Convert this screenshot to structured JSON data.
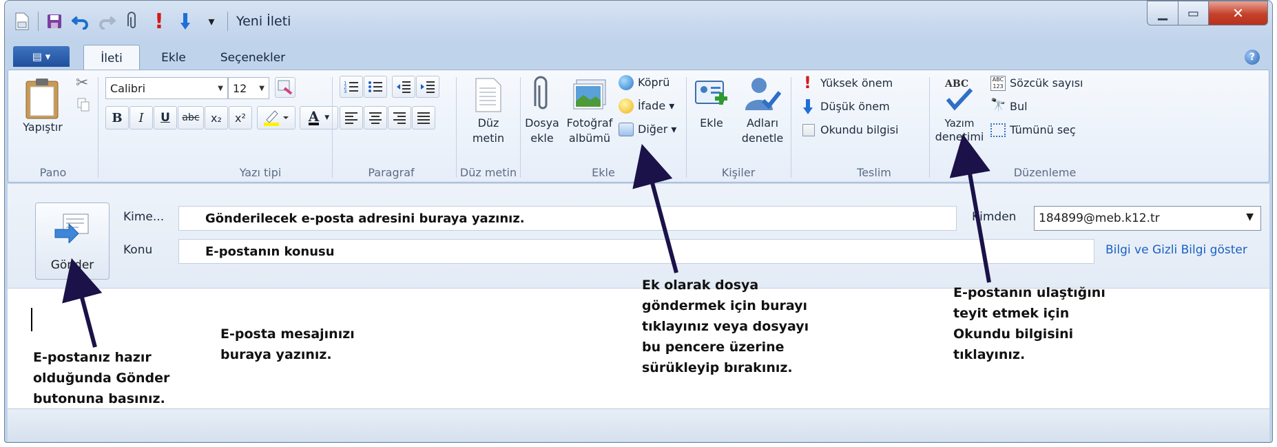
{
  "window": {
    "title": "Yeni İleti"
  },
  "qat": {
    "separator": "|",
    "dropdown": "▾"
  },
  "tabs": {
    "app_menu": "▤ ▾",
    "items": [
      "İleti",
      "Ekle",
      "Seçenekler"
    ],
    "active": "İleti",
    "help": "?"
  },
  "ribbon": {
    "pano": {
      "paste": "Yapıştır",
      "label": "Pano"
    },
    "font": {
      "family": "Calibri",
      "size": "12",
      "bold": "B",
      "italic": "I",
      "underline": "U",
      "strike": "abc",
      "subscript": "x₂",
      "superscript": "x²",
      "font_color": "A",
      "label": "Yazı tipi"
    },
    "paragraph": {
      "label": "Paragraf"
    },
    "plain": {
      "line1": "Düz",
      "line2": "metin",
      "label": "Düz metin"
    },
    "insert": {
      "attach_line1": "Dosya",
      "attach_line2": "ekle",
      "photo_line1": "Fotoğraf",
      "photo_line2": "albümü",
      "link": "Köprü",
      "emoticon": "İfade ▾",
      "other": "Diğer ▾",
      "label": "Ekle"
    },
    "contacts": {
      "add": "Ekle",
      "check_line1": "Adları",
      "check_line2": "denetle",
      "label": "Kişiler"
    },
    "delivery": {
      "high": "Yüksek önem",
      "low": "Düşük önem",
      "receipt": "Okundu bilgisi",
      "label": "Teslim"
    },
    "editing": {
      "spell_line1": "Yazım",
      "spell_line2": "denetimi",
      "word_count": "Sözcük sayısı",
      "find": "Bul",
      "select_all": "Tümünü seç",
      "label": "Düzenleme"
    }
  },
  "header": {
    "send": "Gönder",
    "to_label": "Kime...",
    "to_value": "Gönderilecek e-posta adresini buraya yazınız.",
    "subject_label": "Konu",
    "subject_value": "E-postanın konusu",
    "from_label": "Kimden",
    "from_value": "184899@meb.k12.tr",
    "cc_link": "Bilgi ve Gizli Bilgi göster"
  },
  "notes": {
    "send_note": [
      "E-postanız hazır",
      "olduğunda Gönder",
      "butonuna basınız."
    ],
    "body_note": [
      "E-posta mesajınızı",
      "buraya yazınız."
    ],
    "attach_note": [
      "Ek olarak dosya",
      "göndermek için burayı",
      "tıklayınız veya dosyayı",
      "bu pencere üzerine",
      "sürükleyip bırakınız."
    ],
    "receipt_note": [
      "E-postanın ulaştığını",
      "teyit etmek için",
      "Okundu bilgisini",
      "tıklayınız."
    ]
  },
  "colors": {
    "arrow": "#1a1248",
    "link": "#1a5fc2",
    "important": "#d11a1a",
    "low": "#1f6fd6"
  }
}
